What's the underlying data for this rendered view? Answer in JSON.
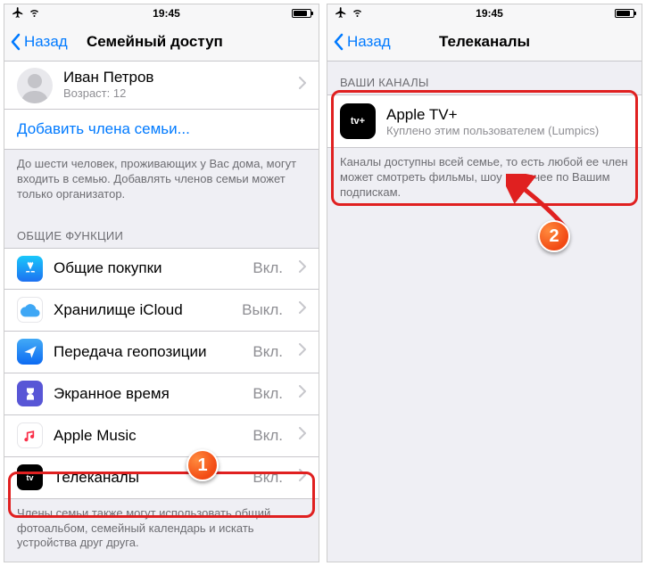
{
  "statusbar": {
    "time": "19:45"
  },
  "screen1": {
    "back": "Назад",
    "title": "Семейный доступ",
    "member": {
      "name": "Иван Петров",
      "age_label": "Возраст: 12"
    },
    "add_member": "Добавить члена семьи...",
    "footer1": "До шести человек, проживающих у Вас дома, могут входить в семью. Добавлять членов семьи может только организатор.",
    "group_header": "ОБЩИЕ ФУНКЦИИ",
    "rows": {
      "purchases": {
        "label": "Общие покупки",
        "state": "Вкл."
      },
      "icloud": {
        "label": "Хранилище iCloud",
        "state": "Выкл."
      },
      "location": {
        "label": "Передача геопозиции",
        "state": "Вкл."
      },
      "screentime": {
        "label": "Экранное время",
        "state": "Вкл."
      },
      "music": {
        "label": "Apple Music",
        "state": "Вкл."
      },
      "tv": {
        "label": "Телеканалы",
        "state": "Вкл."
      }
    },
    "footer2": "Члены семьи также могут использовать общий фотоальбом, семейный календарь и искать устройства друг друга."
  },
  "screen2": {
    "back": "Назад",
    "title": "Телеканалы",
    "group_header": "ВАШИ КАНАЛЫ",
    "channel": {
      "title": "Apple TV+",
      "subtitle": "Куплено этим пользователем (Lumpics)"
    },
    "footer": "Каналы доступны всей семье, то есть любой ее член может смотреть фильмы, шоу и прочее по Вашим подпискам."
  },
  "annotations": {
    "step1": "1",
    "step2": "2"
  }
}
